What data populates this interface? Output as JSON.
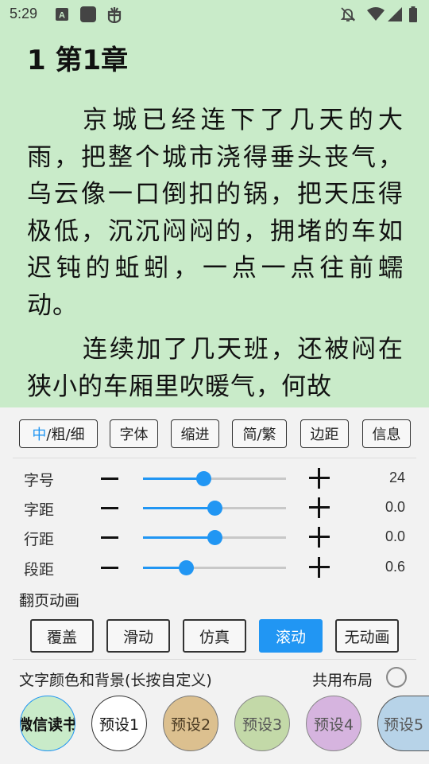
{
  "status_bar": {
    "time": "5:29",
    "icons": [
      "a-square-icon",
      "app-square-icon",
      "bug-icon",
      "bell-off-icon",
      "wifi-icon",
      "signal-icon",
      "battery-icon"
    ]
  },
  "reader": {
    "chapter_title": "1 第1章",
    "paragraphs": [
      "京城已经连下了几天的大雨，把整个城市浇得垂头丧气，乌云像一口倒扣的锅，把天压得极低，沉沉闷闷的，拥堵的车如迟钝的蚯蚓，一点一点往前蠕动。",
      "连续加了几天班，还被闷在狭小的车厢里吹暖气，何故"
    ]
  },
  "toolbar": {
    "weight_selected": "中",
    "weight_rest": "/粗/细",
    "font": "字体",
    "indent": "缩进",
    "convert": "简/繁",
    "margin": "边距",
    "info": "信息"
  },
  "sliders": [
    {
      "label": "字号",
      "value": "24",
      "fraction": 0.42
    },
    {
      "label": "字距",
      "value": "0.0",
      "fraction": 0.5
    },
    {
      "label": "行距",
      "value": "0.0",
      "fraction": 0.5
    },
    {
      "label": "段距",
      "value": "0.6",
      "fraction": 0.3
    }
  ],
  "page_animation": {
    "title": "翻页动画",
    "options": [
      "覆盖",
      "滑动",
      "仿真",
      "滚动",
      "无动画"
    ],
    "selected": "滚动"
  },
  "color_bg": {
    "title": "文字颜色和背景(长按自定义)",
    "shared_layout_label": "共用布局",
    "presets": [
      {
        "label": "微信读书",
        "bg": "#c9ebc9",
        "fg": "#111111",
        "border": "#2196f3"
      },
      {
        "label": "预设1",
        "bg": "#ffffff",
        "fg": "#111111",
        "border": "#333333"
      },
      {
        "label": "预设2",
        "bg": "#dcc08f",
        "fg": "#4a3a22",
        "border": "#777777"
      },
      {
        "label": "预设3",
        "bg": "#c3d9a8",
        "fg": "#555555",
        "border": "#888888"
      },
      {
        "label": "预设4",
        "bg": "#d6b4df",
        "fg": "#555555",
        "border": "#888888"
      },
      {
        "label": "预设5",
        "bg": "#b7d3e8",
        "fg": "#555555",
        "border": "#555555"
      }
    ]
  },
  "colors": {
    "accent": "#2196f3",
    "reader_bg": "#c9ebc9",
    "panel_bg": "#f2f2f2"
  }
}
